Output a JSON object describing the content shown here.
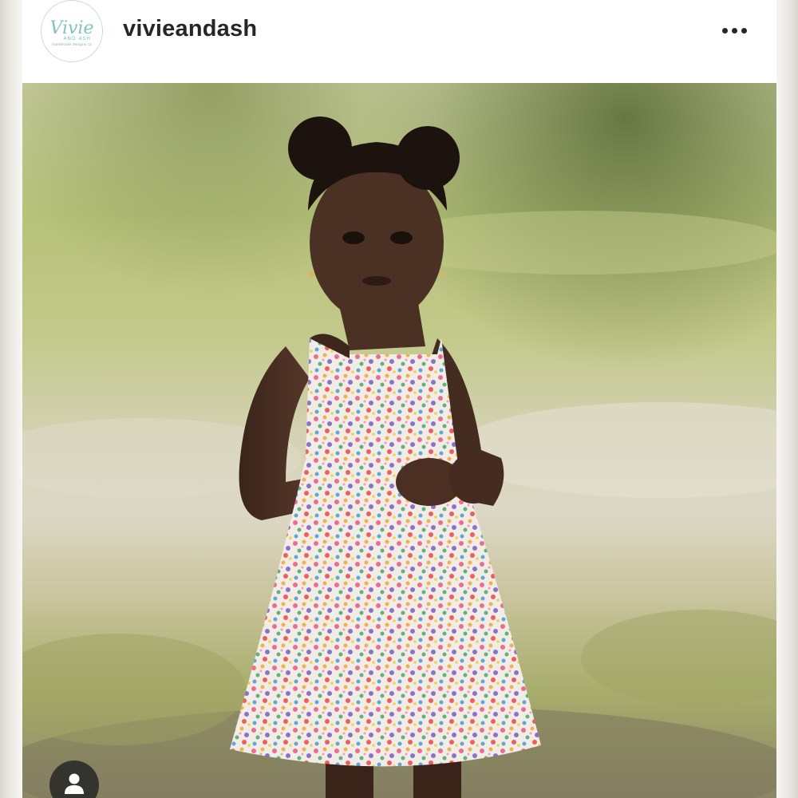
{
  "post": {
    "username": "vivieandash",
    "avatar_logo": {
      "script_text": "Vivie",
      "sub_text": "AND ASH",
      "tagline": "handmade designs co"
    },
    "more_icon": "more-horizontal-icon",
    "photo": {
      "subject": "photo"
    },
    "user_tag_icon": "user-tag-icon"
  },
  "colors": {
    "username": "#262626",
    "logo_teal": "#7fc4bd",
    "tag_button_bg": "#262626"
  }
}
